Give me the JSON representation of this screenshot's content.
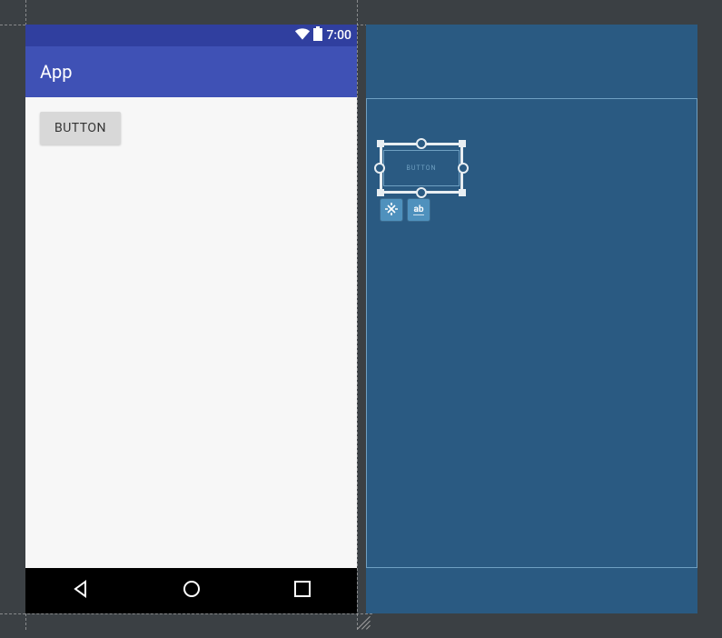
{
  "statusBar": {
    "time": "7:00"
  },
  "appBar": {
    "title": "App"
  },
  "content": {
    "button_label": "BUTTON"
  },
  "blueprint": {
    "widget_label": "BUTTON",
    "tool_ab_label": "ab"
  }
}
